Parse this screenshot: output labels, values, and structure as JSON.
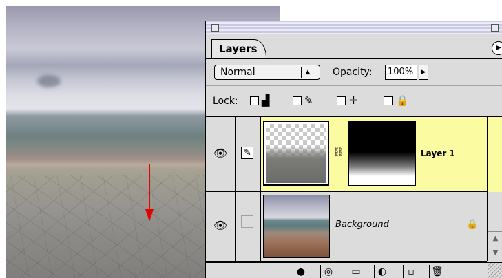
{
  "palette": {
    "tab_label": "Layers",
    "menu_icon": "palette-menu-arrow-icon",
    "blend_mode": {
      "selected": "Normal"
    },
    "opacity": {
      "label": "Opacity:",
      "value": "100%"
    },
    "lock": {
      "label": "Lock:"
    },
    "layers": [
      {
        "name": "Layer 1",
        "visible": true,
        "has_mask": true,
        "active": true
      },
      {
        "name": "Background",
        "visible": true,
        "locked": true,
        "active": false
      }
    ],
    "bottom_tools": [
      "layer-style-icon",
      "add-mask-icon",
      "new-set-icon",
      "adjustment-layer-icon",
      "new-layer-icon",
      "trash-icon"
    ]
  },
  "colors": {
    "active_layer_highlight": "#fbfba2",
    "arrow": "#e60000",
    "panel_bg": "#dcdcdc"
  }
}
